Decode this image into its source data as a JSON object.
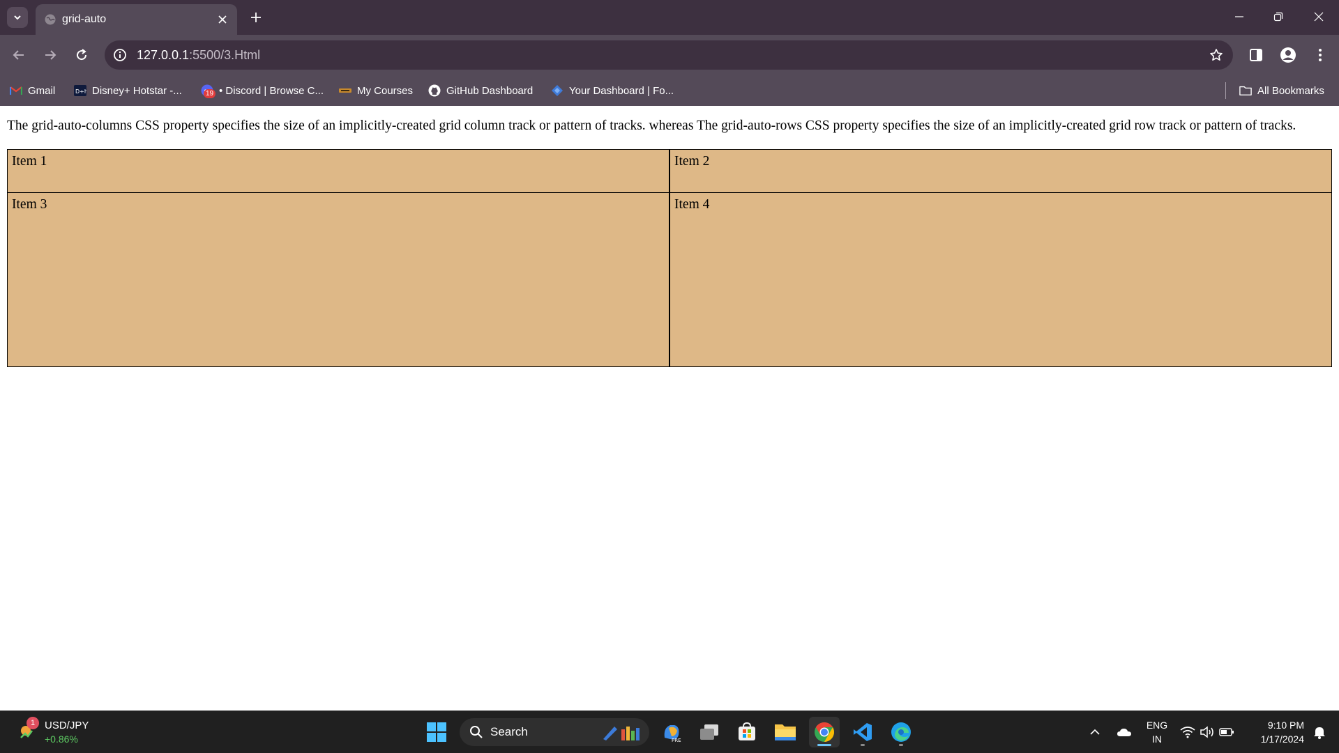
{
  "browser": {
    "tab": {
      "title": "grid-auto",
      "favicon": "globe-icon"
    },
    "address": {
      "host": "127.0.0.1",
      "path": ":5500/3.Html"
    },
    "bookmarks": [
      {
        "label": "Gmail",
        "icon": "gmail-icon"
      },
      {
        "label": "Disney+ Hotstar -...",
        "icon": "hotstar-icon"
      },
      {
        "label": "• Discord | Browse C...",
        "icon": "discord-icon",
        "badge": "19"
      },
      {
        "label": "My Courses",
        "icon": "courses-icon"
      },
      {
        "label": "GitHub Dashboard",
        "icon": "github-icon"
      },
      {
        "label": "Your Dashboard | Fo...",
        "icon": "dashboard-icon"
      }
    ],
    "all_bookmarks": "All Bookmarks"
  },
  "page": {
    "paragraph": "The grid-auto-columns CSS property specifies the size of an implicitly-created grid column track or pattern of tracks. whereas The grid-auto-rows CSS property specifies the size of an implicitly-created grid row track or pattern of tracks.",
    "items": [
      "Item 1",
      "Item 2",
      "Item 3",
      "Item 4"
    ],
    "item_background": "#deb887"
  },
  "taskbar": {
    "widget": {
      "badge": "1",
      "name": "USD/JPY",
      "change": "+0.86%"
    },
    "search_label": "Search",
    "tray": {
      "lang_line1": "ENG",
      "lang_line2": "IN"
    },
    "clock": {
      "time": "9:10 PM",
      "date": "1/17/2024"
    }
  },
  "colors": {
    "titlebar": "#3d3040",
    "toolbar": "#544a58",
    "taskbar": "#202020",
    "accent": "#6cc5f7"
  }
}
